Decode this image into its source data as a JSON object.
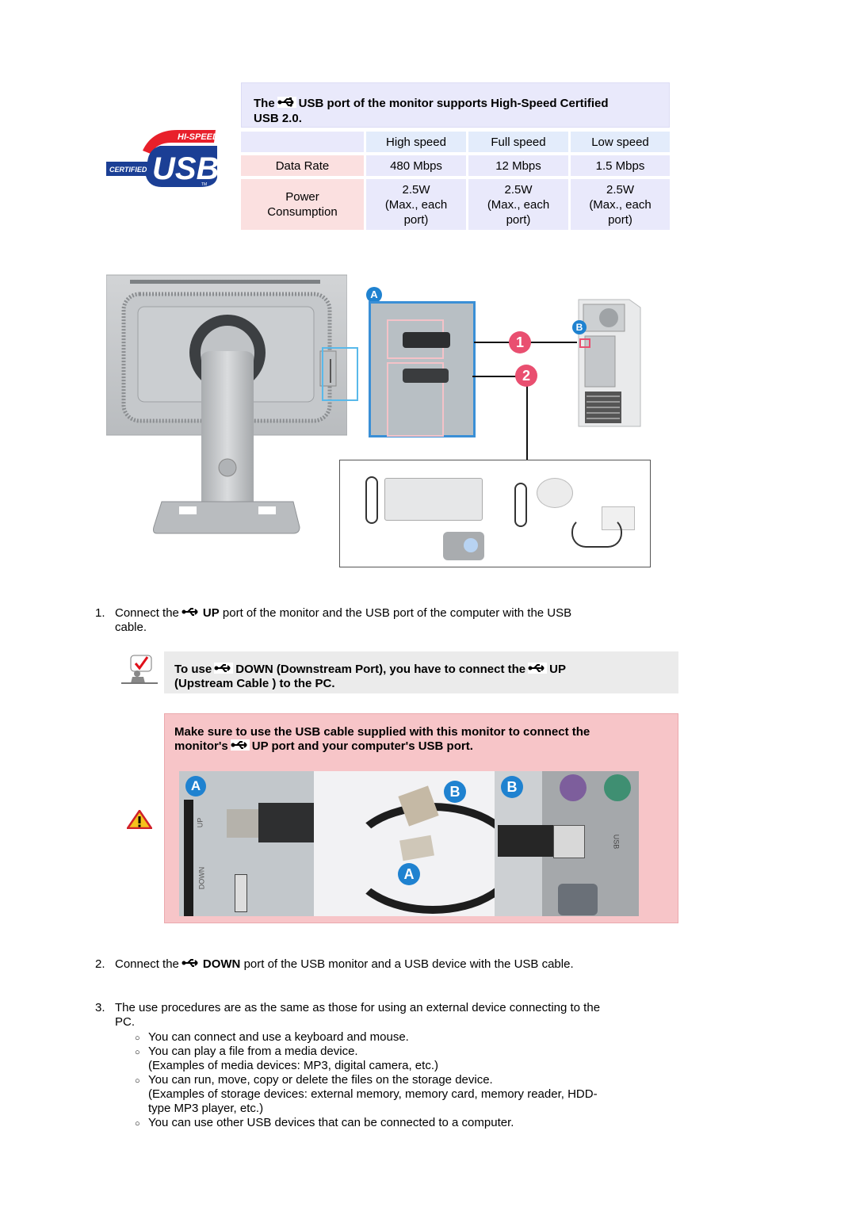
{
  "usb_logo": {
    "top_text": "HI-SPEED",
    "left_text": "CERTIFIED",
    "main_text": "USB",
    "tm": "TM"
  },
  "spec_table": {
    "title_prefix": "The",
    "title_icon": "usb-icon",
    "title_line1_rest": "USB port of the monitor supports High-Speed Certified",
    "title_line2": "USB 2.0.",
    "columns": [
      "",
      "High speed",
      "Full speed",
      "Low speed"
    ],
    "rows": [
      {
        "label": "Data Rate",
        "values": [
          "480 Mbps",
          "12 Mbps",
          "1.5 Mbps"
        ]
      },
      {
        "label_line1": "Power",
        "label_line2": "Consumption",
        "values": [
          {
            "l1": "2.5W",
            "l2": "(Max., each",
            "l3": "port)"
          },
          {
            "l1": "2.5W",
            "l2": "(Max., each",
            "l3": "port)"
          },
          {
            "l1": "2.5W",
            "l2": "(Max., each",
            "l3": "port)"
          }
        ]
      }
    ]
  },
  "diagram": {
    "callout_a": "A",
    "callout_b": "B",
    "step_1": "1",
    "step_2": "2",
    "port_up_label": "UP",
    "port_down_label": "DOWN",
    "devices": [
      "keyboard",
      "mouse",
      "digital camera",
      "external storage"
    ]
  },
  "steps": [
    {
      "number": "1.",
      "pre": "Connect the",
      "bold": "UP",
      "post": "port of the monitor and the USB port of the computer with the USB",
      "line2": "cable."
    },
    {
      "number": "2.",
      "pre": "Connect the",
      "bold": "DOWN",
      "post": "port of the USB monitor and a USB device with the USB cable."
    },
    {
      "number": "3.",
      "line1": "The use procedures are as the same as those for using an external device connecting to the",
      "line2": "PC."
    }
  ],
  "note": {
    "icon": "note-check-icon",
    "l1_pre": "To use",
    "l1_mid": "DOWN (Downstream Port), you have to connect the",
    "l1_post": "UP",
    "l2": "(Upstream Cable ) to the PC."
  },
  "warning": {
    "icon": "warning-triangle-icon",
    "l1": "Make sure to use the USB cable supplied with this monitor to connect the",
    "l2_pre": "monitor's",
    "l2_post": "UP port and your computer's USB port.",
    "photo_labels": {
      "a1": "A",
      "b1": "B",
      "a2": "A",
      "b2": "B",
      "up": "UP",
      "down": "DOWN",
      "usb": "USB"
    }
  },
  "sub_items": [
    {
      "lines": [
        "You can connect and use a keyboard and mouse."
      ]
    },
    {
      "lines": [
        "You can play a file from a media device.",
        "(Examples of media devices: MP3, digital camera, etc.)"
      ]
    },
    {
      "lines": [
        "You can run, move, copy or delete the files on the storage device.",
        "(Examples of storage devices: external memory, memory card, memory reader, HDD-",
        "type MP3 player, etc.)"
      ]
    },
    {
      "lines": [
        "You can use other USB devices that can be connected to a computer."
      ]
    }
  ],
  "colors": {
    "accent_blue": "#1f82d0",
    "callout_pink": "#e94f70",
    "table_header": "#e3ecfb",
    "table_label": "#fbe0e0",
    "table_value": "#e9e9fb",
    "warning_bg": "#f7c5c8",
    "note_bg": "#ebebeb"
  }
}
